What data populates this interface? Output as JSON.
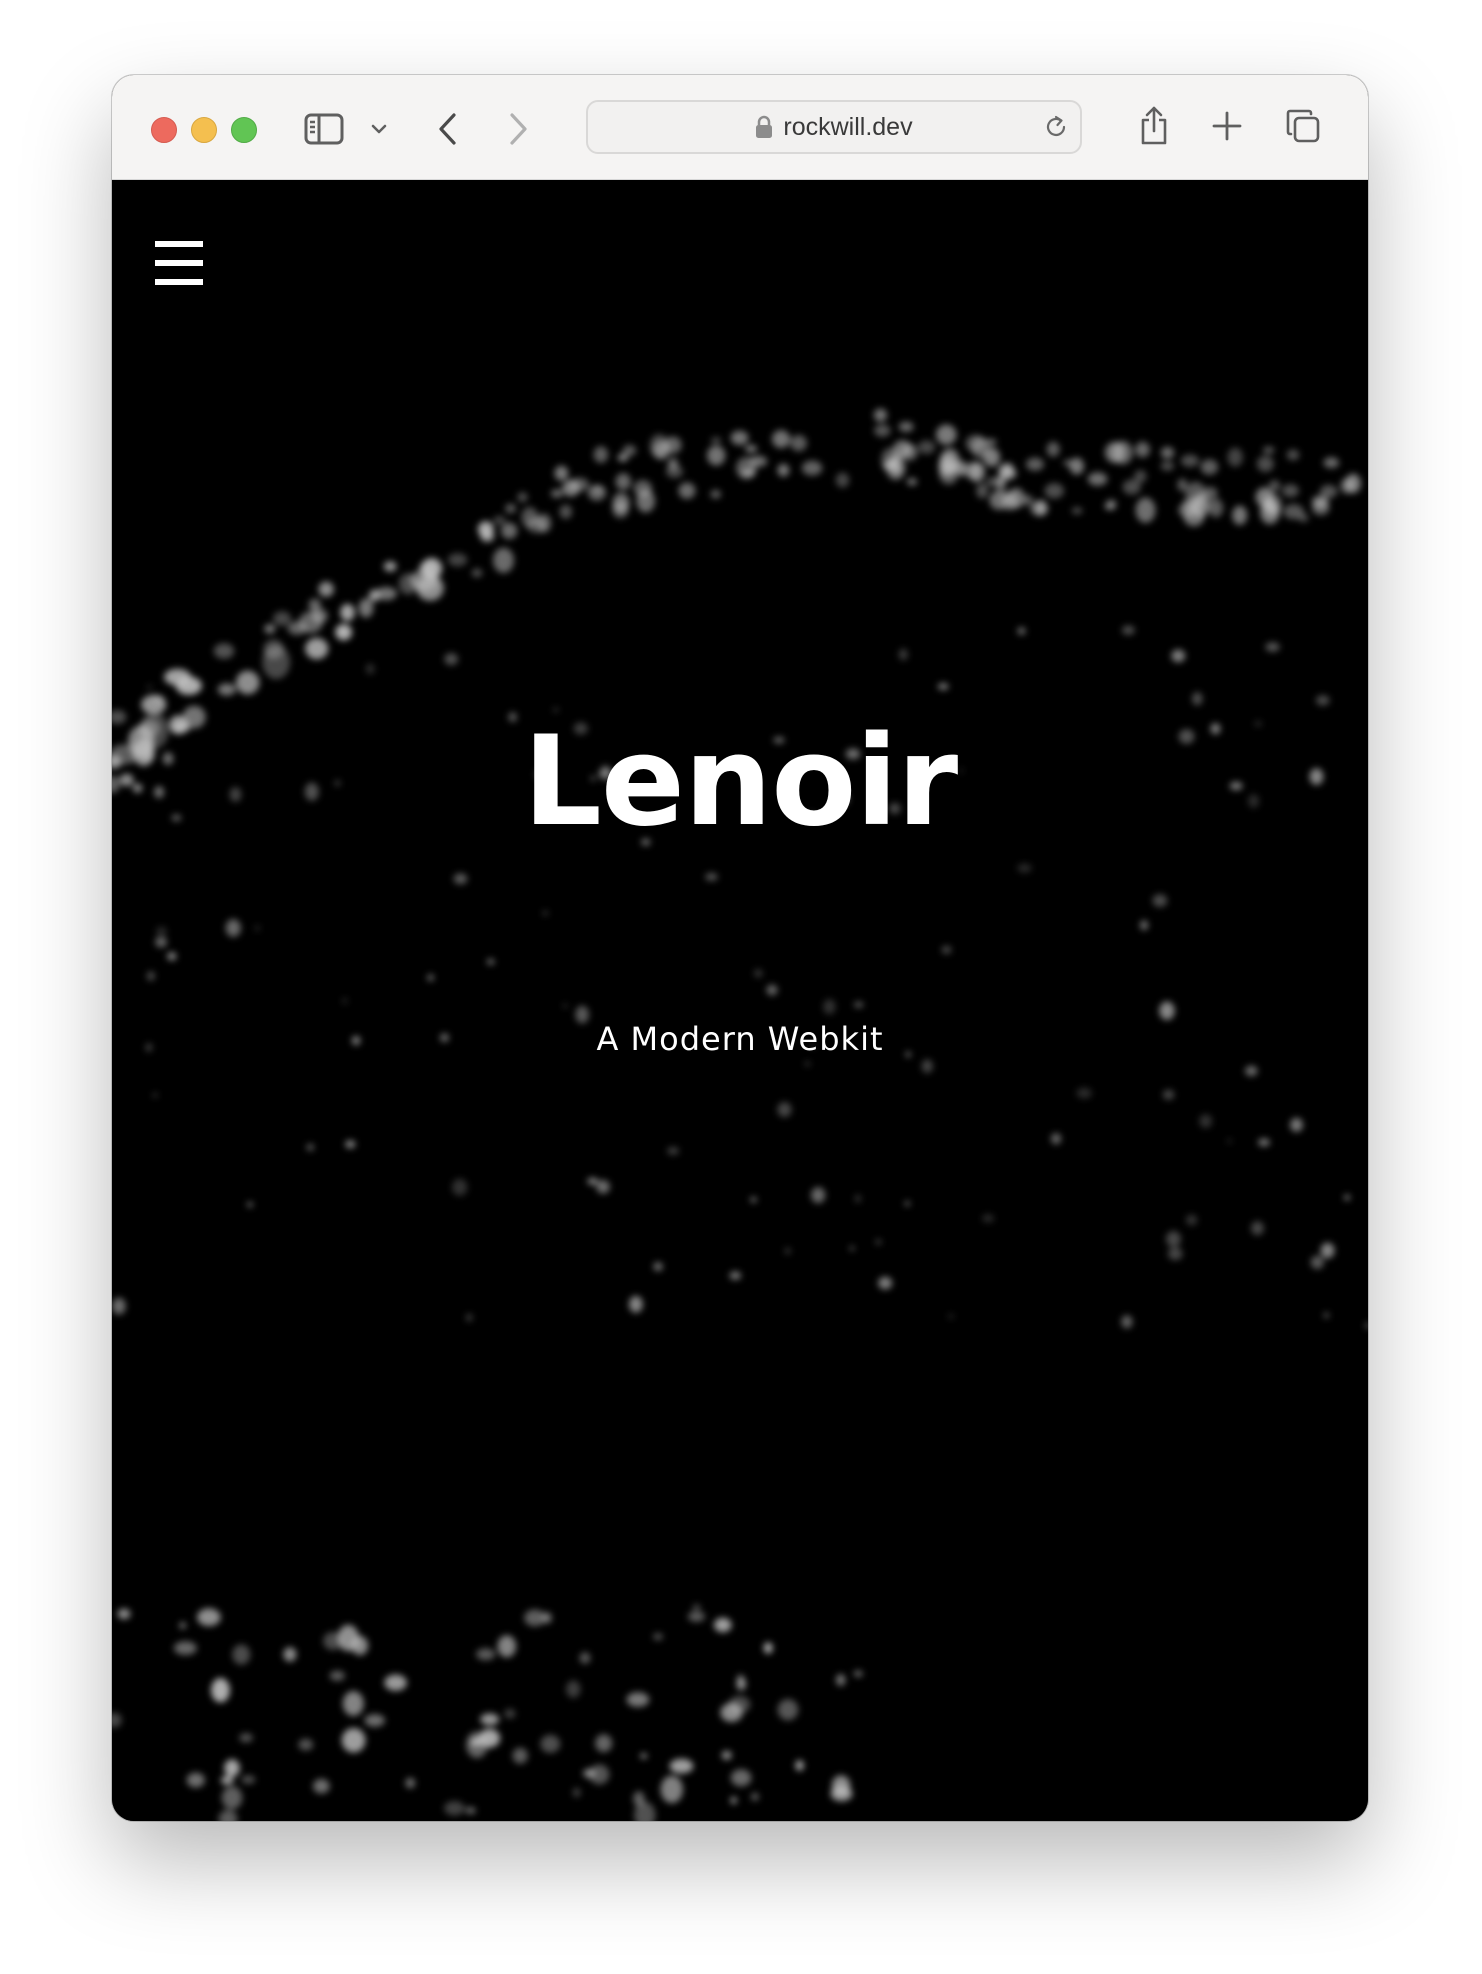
{
  "browser": {
    "url": "rockwill.dev",
    "icons": {
      "sidebar": "sidebar-icon",
      "sidebar_menu": "chevron-down-icon",
      "back": "chevron-left-icon",
      "forward": "chevron-right-icon",
      "lock": "lock-icon",
      "reload": "reload-icon",
      "share": "share-icon",
      "new_tab": "plus-icon",
      "tabs": "tabs-overview-icon"
    }
  },
  "page": {
    "menu_icon": "hamburger-menu-icon",
    "title": "Lenoir",
    "subtitle": "A Modern Webkit",
    "colors": {
      "background": "#000000",
      "text": "#ffffff",
      "particles": "#bdbdbd"
    }
  }
}
